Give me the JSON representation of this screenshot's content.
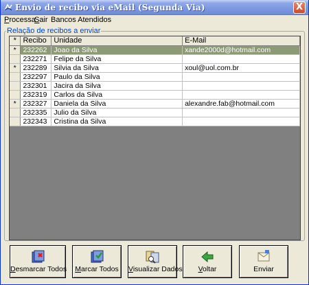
{
  "window": {
    "title": "Envio de recibo via eMail (Segunda Via)",
    "close_label": "X"
  },
  "menu": {
    "processa": {
      "mnemonic": "P",
      "rest": "rocessa"
    },
    "sair": {
      "mnemonic": "S",
      "rest": "air"
    },
    "bancos": "Bancos Atendidos"
  },
  "group": {
    "label": "Relação de recibos a enviar"
  },
  "table": {
    "headers": {
      "sel": "*",
      "recibo": "Recibo",
      "unidade": "Unidade",
      "email": "E-Mail"
    },
    "rows": [
      {
        "mark": "*",
        "recibo": "232262",
        "unidade": "Joao da Silva",
        "email": "xande2000d@hotmail.com"
      },
      {
        "mark": "",
        "recibo": "232271",
        "unidade": "Felipe da Silva",
        "email": ""
      },
      {
        "mark": "*",
        "recibo": "232289",
        "unidade": "Silvia da Silva",
        "email": "xoul@uol.com.br"
      },
      {
        "mark": "",
        "recibo": "232297",
        "unidade": "Paulo da Silva",
        "email": ""
      },
      {
        "mark": "",
        "recibo": "232301",
        "unidade": "Jacira da Silva",
        "email": ""
      },
      {
        "mark": "",
        "recibo": "232319",
        "unidade": "Carlos da Silva",
        "email": ""
      },
      {
        "mark": "*",
        "recibo": "232327",
        "unidade": "Daniela da Silva",
        "email": "alexandre.fab@hotmail.com"
      },
      {
        "mark": "",
        "recibo": "232335",
        "unidade": "Julio da Silva",
        "email": ""
      },
      {
        "mark": "",
        "recibo": "232343",
        "unidade": "Cristina da Silva",
        "email": ""
      }
    ]
  },
  "buttons": {
    "desmarcar": {
      "mnemonic": "D",
      "rest": "esmarcar Todos",
      "icon": "uncheck-all-icon"
    },
    "marcar": {
      "mnemonic": "M",
      "rest": "arcar Todos",
      "icon": "check-all-icon"
    },
    "visualizar": {
      "mnemonic": "V",
      "rest": "isualizar Dados",
      "icon": "view-data-icon"
    },
    "voltar": {
      "mnemonic": "V",
      "rest": "oltar",
      "icon": "back-arrow-icon"
    },
    "enviar": {
      "label": "Enviar",
      "icon": "send-icon"
    }
  },
  "colors": {
    "selected_row": "#8c9a76",
    "grid_background": "#808080",
    "group_label": "#0046d5"
  }
}
